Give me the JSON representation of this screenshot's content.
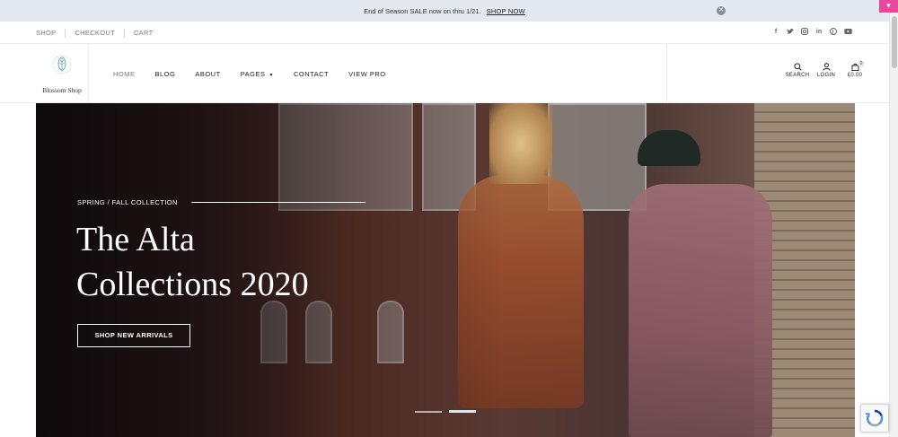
{
  "announcement": {
    "text": "End of Season SALE now on thru 1/21.",
    "link": "SHOP NOW",
    "close_icon": "close-icon"
  },
  "top_links": [
    "SHOP",
    "CHECKOUT",
    "CART"
  ],
  "social_icons": [
    "facebook-icon",
    "twitter-icon",
    "instagram-icon",
    "linkedin-icon",
    "pinterest-icon",
    "youtube-icon"
  ],
  "brand": {
    "name": "Blossom Shop",
    "accent": "#7fb3c4"
  },
  "nav": {
    "home": "HOME",
    "blog": "BLOG",
    "about": "ABOUT",
    "pages": "PAGES",
    "contact": "CONTACT",
    "view_pro": "VIEW PRO"
  },
  "header_actions": {
    "search": "SEARCH",
    "login": "LOGIN",
    "cart_total": "£0.00",
    "cart_count": "0"
  },
  "hero": {
    "eyebrow": "SPRING / FALL COLLECTION",
    "title_line1": "The Alta",
    "title_line2": "Collections 2020",
    "button": "SHOP NEW ARRIVALS",
    "active_slide": 2,
    "slide_count": 2
  },
  "colors": {
    "announcement_bg": "#e3e9ee",
    "corner_badge": "#e8479a"
  }
}
